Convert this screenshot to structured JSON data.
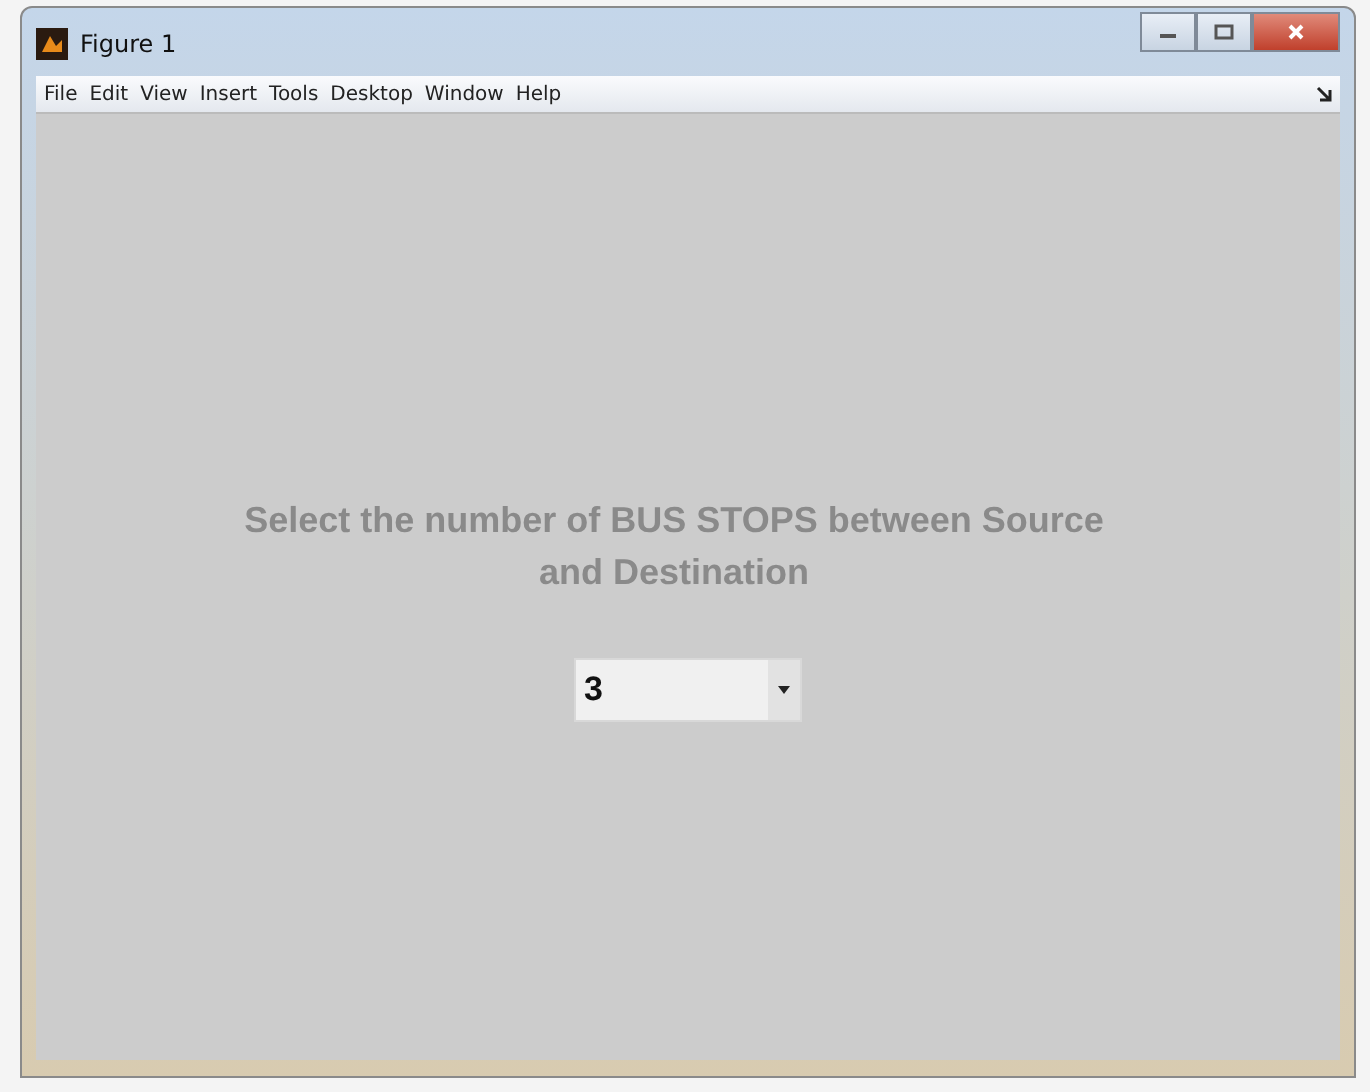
{
  "window": {
    "title": "Figure 1"
  },
  "menu": [
    "File",
    "Edit",
    "View",
    "Insert",
    "Tools",
    "Desktop",
    "Window",
    "Help"
  ],
  "prompt": "Select the number of BUS STOPS between Source and Destination",
  "dropdown": {
    "value": "3"
  }
}
